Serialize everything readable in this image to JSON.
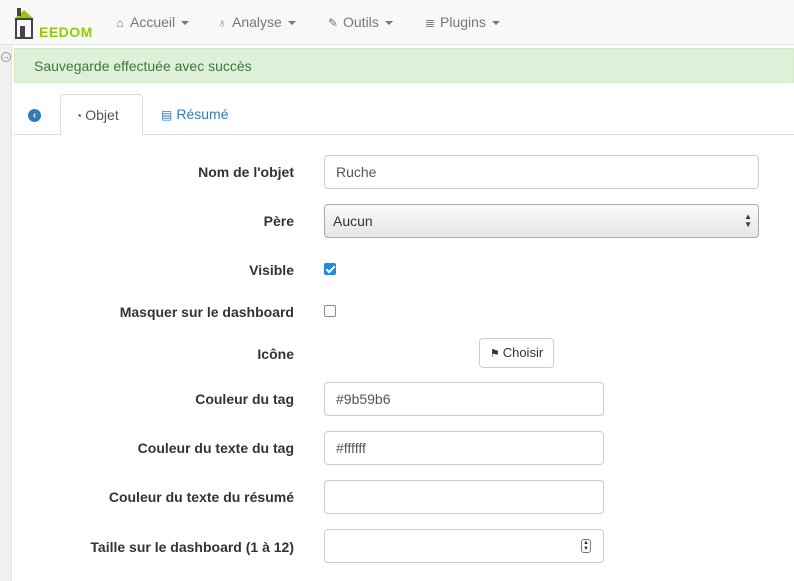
{
  "brand": {
    "logo_text": "EEDOM"
  },
  "nav": [
    {
      "icon": "home-icon",
      "glyph": "⌂",
      "label": "Accueil"
    },
    {
      "icon": "stethoscope-icon",
      "glyph": "♁",
      "label": "Analyse"
    },
    {
      "icon": "wrench-icon",
      "glyph": "🔧",
      "label": "Outils"
    },
    {
      "icon": "server-icon",
      "glyph": "≣",
      "label": "Plugins"
    }
  ],
  "alert": {
    "message": "Sauvegarde effectuée avec succès"
  },
  "tabs": {
    "objet": "Objet",
    "resume": "Résumé"
  },
  "form": {
    "nom_label": "Nom de l'objet",
    "nom_value": "Ruche",
    "pere_label": "Père",
    "pere_value": "Aucun",
    "visible_label": "Visible",
    "visible_checked": true,
    "masquer_label": "Masquer sur le dashboard",
    "masquer_checked": false,
    "icone_label": "Icône",
    "choisir_label": "Choisir",
    "couleur_tag_label": "Couleur du tag",
    "couleur_tag_value": "#9b59b6",
    "couleur_texte_tag_label": "Couleur du texte du tag",
    "couleur_texte_tag_value": "#ffffff",
    "couleur_texte_resume_label": "Couleur du texte du résumé",
    "couleur_texte_resume_value": "",
    "taille_label": "Taille sur le dashboard (1 à 12)",
    "taille_value": ""
  },
  "colors": {
    "brand_green": "#94ca02",
    "alert_bg": "#dff0d8",
    "alert_text": "#3c763d",
    "link_blue": "#337ab7",
    "checkbox_blue": "#1e88e5"
  }
}
